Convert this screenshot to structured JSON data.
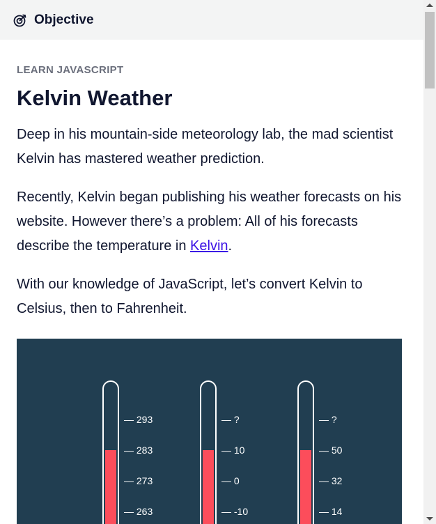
{
  "header": {
    "title": "Objective",
    "icon": "target-icon"
  },
  "article": {
    "eyebrow": "LEARN JAVASCRIPT",
    "title": "Kelvin Weather",
    "paragraph1": "Deep in his mountain-side meteorology lab, the mad scientist Kelvin has mastered weather prediction.",
    "paragraph2_before": "Recently, Kelvin began publishing his weather forecasts on his website. However there’s a problem: All of his forecasts describe the temperature in ",
    "paragraph2_link": "Kelvin",
    "paragraph2_after": ".",
    "paragraph3": "With our knowledge of JavaScript, let’s convert Kelvin to Celsius, then to Fahrenheit."
  },
  "figure": {
    "background": "#213e51",
    "fill_color": "#fc4d5b",
    "thermometers": [
      {
        "name": "kelvin",
        "labels": [
          "— 293",
          "— 283",
          "— 273",
          "— 263"
        ]
      },
      {
        "name": "celsius",
        "labels": [
          "— ?",
          "— 10",
          "— 0",
          "— -10"
        ]
      },
      {
        "name": "fahrenheit",
        "labels": [
          "— ?",
          "— 50",
          "— 32",
          "— 14"
        ]
      }
    ]
  }
}
